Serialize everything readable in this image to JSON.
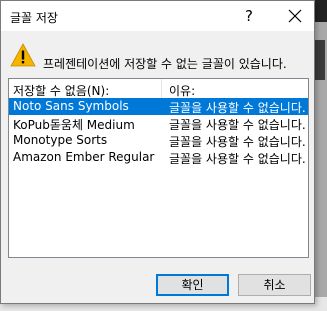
{
  "dialog": {
    "title": "글꼴 저장",
    "help_label": "?",
    "message": "프레젠테이션에 저장할 수 없는 글꼴이 있습니다.",
    "list": {
      "column1": "저장할 수 없음(N):",
      "column2": "이유:",
      "rows": [
        {
          "font": "Noto Sans Symbols",
          "reason": "글꼴을 사용할 수 없습니다.",
          "selected": true
        },
        {
          "font": "KoPub돋움체 Medium",
          "reason": "글꼴을 사용할 수 없습니다.",
          "selected": false
        },
        {
          "font": "Monotype Sorts",
          "reason": "글꼴을 사용할 수 없습니다.",
          "selected": false
        },
        {
          "font": "Amazon Ember Regular",
          "reason": "글꼴을 사용할 수 없습니다.",
          "selected": false
        }
      ]
    },
    "buttons": {
      "ok": "확인",
      "cancel": "취소"
    }
  },
  "colors": {
    "selection": "#0078d7",
    "warning": "#f4b400"
  },
  "icons": {
    "warning": "warning-icon",
    "close": "close-icon"
  }
}
